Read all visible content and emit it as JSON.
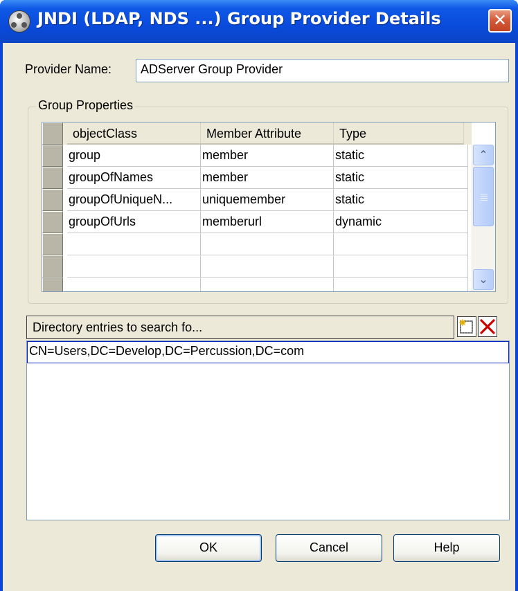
{
  "window": {
    "title": "JNDI (LDAP, NDS ...) Group Provider Details",
    "close_glyph": "✕",
    "title_icon": "provider-app-icon"
  },
  "provider": {
    "label": "Provider Name:",
    "value": "ADServer Group Provider"
  },
  "group_properties": {
    "legend": "Group Properties",
    "columns": [
      "objectClass",
      "Member Attribute",
      "Type"
    ],
    "rows": [
      [
        "group",
        "member",
        "static"
      ],
      [
        "groupOfNames",
        "member",
        "static"
      ],
      [
        "groupOfUniqueN...",
        "uniquemember",
        "static"
      ],
      [
        "groupOfUrls",
        "memberurl",
        "dynamic"
      ],
      [
        "",
        "",
        ""
      ],
      [
        "",
        "",
        ""
      ],
      [
        "",
        "",
        ""
      ]
    ],
    "scroll_up_glyph": "⌃",
    "scroll_down_glyph": "⌄"
  },
  "directory": {
    "header": "Directory entries to search fo...",
    "entries": [
      "CN=Users,DC=Develop,DC=Percussion,DC=com"
    ],
    "add_icon": "new-entry-icon",
    "delete_icon": "delete-x-icon"
  },
  "buttons": {
    "ok": "OK",
    "cancel": "Cancel",
    "help": "Help"
  },
  "colors": {
    "title_bar": "#0a4bdc",
    "dialog_bg": "#ece9d8",
    "close_button": "#d65b3a",
    "delete_icon": "#cc0000"
  }
}
